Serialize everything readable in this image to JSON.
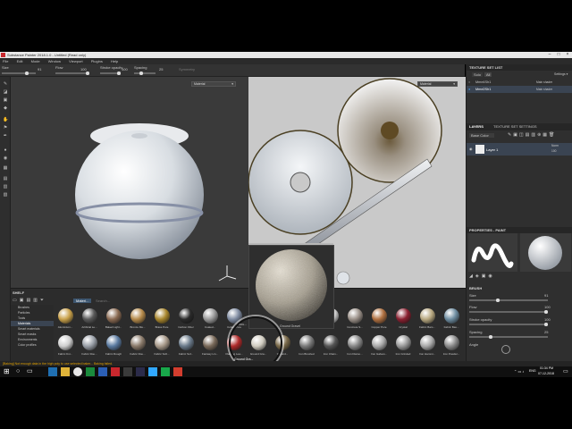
{
  "window": {
    "title": "Substance Painter 2018.1.0 - Untitled (Read only)"
  },
  "menu": [
    "File",
    "Edit",
    "Mode",
    "Window",
    "Viewport",
    "Plugins",
    "Help"
  ],
  "tool_options": {
    "size_label": "Size",
    "size_value": "91",
    "flow_label": "Flow",
    "flow_value": "100",
    "opacity_label": "Stroke opacity",
    "opacity_value": "100",
    "spacing_label": "Spacing",
    "spacing_value": "25",
    "symmetry_label": "Symmetry"
  },
  "viewport3d": {
    "mode": "Material"
  },
  "viewport2d": {
    "mode": "Material"
  },
  "texture_set_list": {
    "title": "TEXTURE SET LIST",
    "filters": [
      "Solo",
      "All"
    ],
    "settings_label": "Settings ▾",
    "items": [
      {
        "name": "Mme4Sh1",
        "shader": "Main shader"
      },
      {
        "name": "Mme2Sh1",
        "shader": "Main shader"
      }
    ]
  },
  "layers": {
    "tabs": [
      "LAYERS",
      "TEXTURE SET SETTINGS"
    ],
    "channel": "Base Color",
    "items": [
      {
        "name": "Layer 1",
        "blend": "Norm",
        "opacity": "100"
      }
    ]
  },
  "properties": {
    "title": "PROPERTIES - PAINT",
    "section": "BRUSH",
    "params": [
      {
        "label": "Size",
        "value": "91"
      },
      {
        "label": "Flow",
        "value": "100"
      },
      {
        "label": "Stroke opacity",
        "value": "100"
      },
      {
        "label": "Spacing",
        "value": "25"
      },
      {
        "label": "Angle",
        "value": ""
      }
    ]
  },
  "shelf": {
    "title": "SHELF",
    "search_placeholder": "Search...",
    "filter_tag": "Materi...",
    "categories": [
      "Brushes",
      "Particles",
      "Tools",
      "Materials",
      "Smart materials",
      "Smart masks",
      "Environments",
      "Color profiles"
    ],
    "active_category": "Materials",
    "row1": [
      "Aluminium...",
      "Artificial Le...",
      "Baked Light...",
      "Bronze Me...",
      "Brass Pure",
      "Carbon Fiber",
      "Coated...",
      "Cobalt Pure",
      "",
      "",
      "",
      "",
      "Concrete S...",
      "Copper Pure",
      "Crystal",
      "Fabric Bam...",
      "Fabric Bas..."
    ],
    "row2": [
      "Fabric Kni...",
      "Fabric Rou...",
      "Fabric Rough",
      "Fabric Rou...",
      "Fabric Soft...",
      "Fabric Suf...",
      "Fantasy Lin...",
      "Flaming Lea...",
      "Ground Gra...",
      "Ground...",
      "Iron Brushed",
      "Iron Chain...",
      "Iron Diamo...",
      "Iron Galvan...",
      "Iron Grinded",
      "Iron Hammi...",
      "Iron Powder..."
    ],
    "preview_label": "Ground Gravel",
    "hover_label": "Ground Gra...",
    "popup_label": "Colou..."
  },
  "status": "[Baking] Not enough data in the high poly to use selected baker... Baking failed.",
  "taskbar": {
    "lang": "ENG",
    "time": "01:34 PM",
    "date": "07-12-2018"
  },
  "colors": {
    "accent": "#3d8fd6",
    "bg": "#2f2f2f",
    "viewport2d": "#c9c9c9"
  }
}
